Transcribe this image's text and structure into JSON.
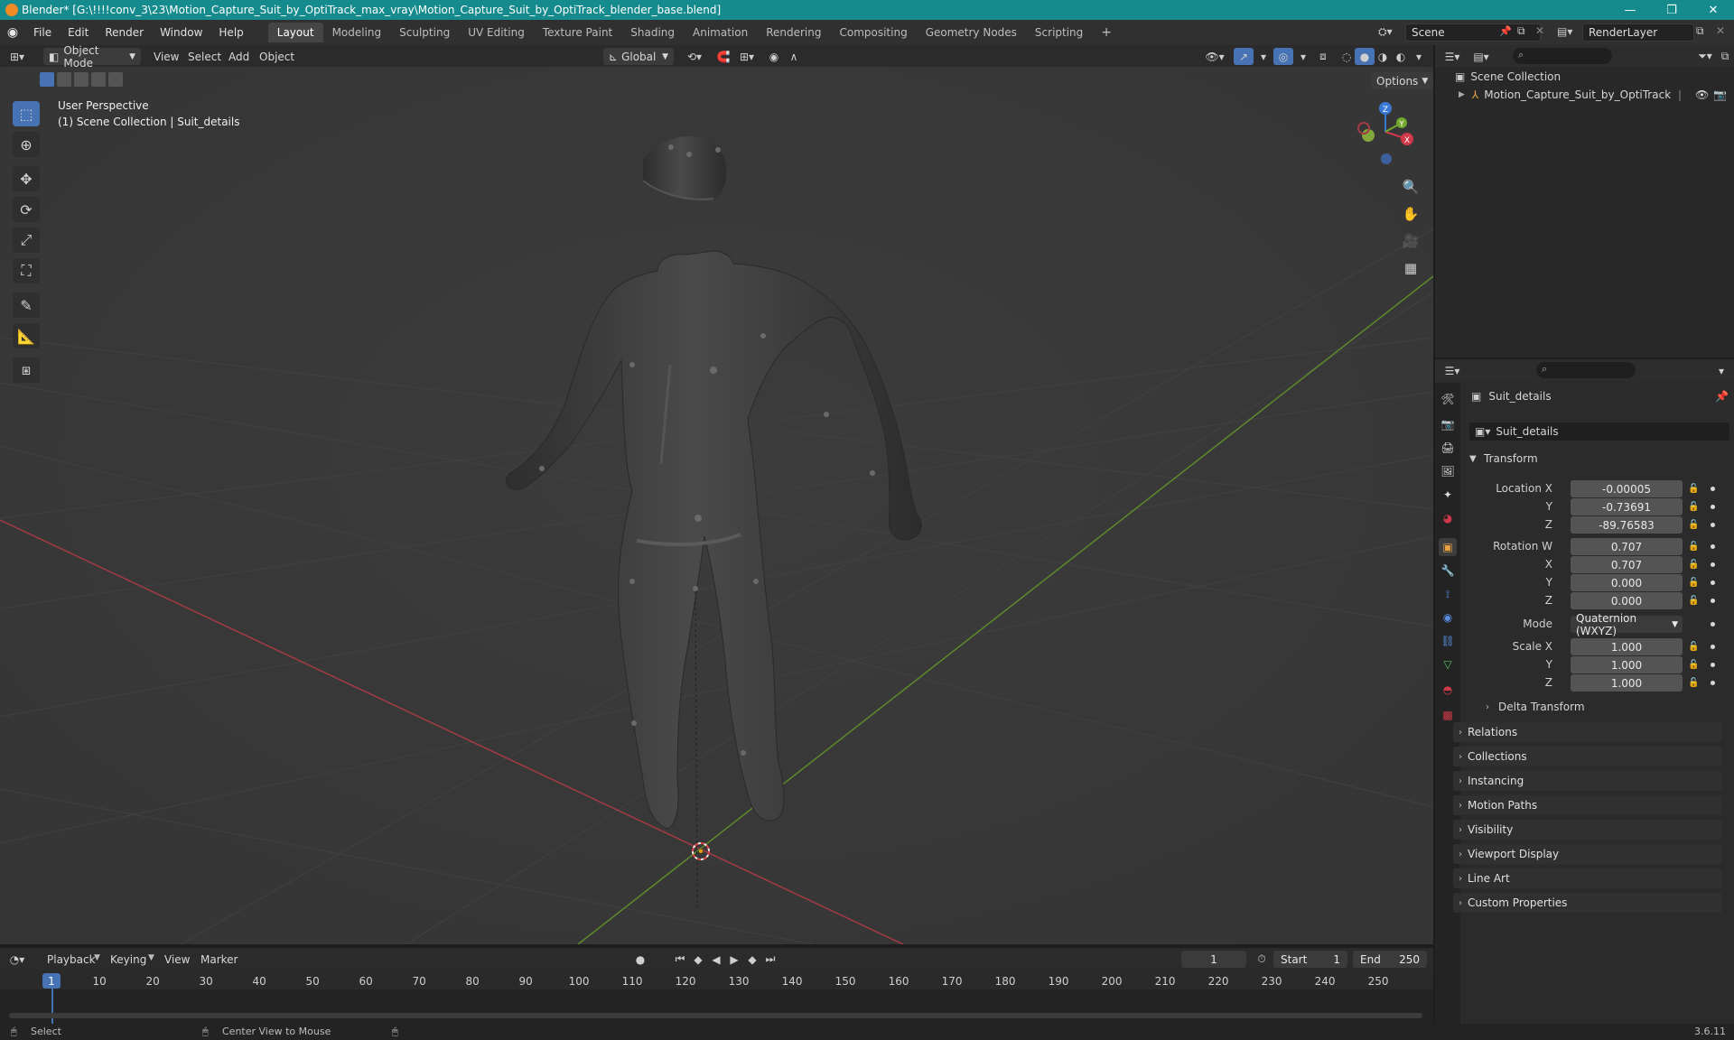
{
  "window": {
    "title": "Blender* [G:\\!!!!conv_3\\23\\Motion_Capture_Suit_by_OptiTrack_max_vray\\Motion_Capture_Suit_by_OptiTrack_blender_base.blend]",
    "minimize": "—",
    "maximize": "❐",
    "close": "✕"
  },
  "menu": [
    "File",
    "Edit",
    "Render",
    "Window",
    "Help"
  ],
  "workspaces": [
    "Layout",
    "Modeling",
    "Sculpting",
    "UV Editing",
    "Texture Paint",
    "Shading",
    "Animation",
    "Rendering",
    "Compositing",
    "Geometry Nodes",
    "Scripting"
  ],
  "active_workspace": "Layout",
  "add_workspace": "+",
  "scene_name": "Scene",
  "view_layer": "RenderLayer",
  "viewport_header": {
    "mode": "Object Mode",
    "menus": [
      "View",
      "Select",
      "Add",
      "Object"
    ],
    "transform_orientation": "Global",
    "options": "Options"
  },
  "viewport": {
    "perspective_label": "User Perspective",
    "collection_label": "(1) Scene Collection | Suit_details",
    "gizmo_axes": {
      "x": "X",
      "y": "Y",
      "z": "Z"
    }
  },
  "outliner": {
    "root": "Scene Collection",
    "items": [
      {
        "name": "Motion_Capture_Suit_by_OptiTrack"
      }
    ]
  },
  "properties": {
    "object_name": "Suit_details",
    "datablock_name": "Suit_details",
    "transform_panel": "Transform",
    "location": {
      "label": "Location X",
      "x": "-0.00005",
      "y": "-0.73691",
      "z": "-89.76583"
    },
    "rotation": {
      "label": "Rotation W",
      "w": "0.707",
      "x": "0.707",
      "y": "0.000",
      "z": "0.000"
    },
    "mode_label": "Mode",
    "mode_value": "Quaternion (WXYZ)",
    "scale": {
      "label": "Scale X",
      "x": "1.000",
      "y": "1.000",
      "z": "1.000"
    },
    "axis_labels": {
      "x": "X",
      "y": "Y",
      "z": "Z"
    },
    "delta_transform": "Delta Transform",
    "panels": [
      "Relations",
      "Collections",
      "Instancing",
      "Motion Paths",
      "Visibility",
      "Viewport Display",
      "Line Art",
      "Custom Properties"
    ]
  },
  "timeline": {
    "menus": [
      "Playback",
      "Keying",
      "View",
      "Marker"
    ],
    "current_frame": "1",
    "start_label": "Start",
    "start": "1",
    "end_label": "End",
    "end": "250",
    "ruler": [
      "1",
      "10",
      "20",
      "30",
      "40",
      "50",
      "60",
      "70",
      "80",
      "90",
      "100",
      "110",
      "120",
      "130",
      "140",
      "150",
      "160",
      "170",
      "180",
      "190",
      "200",
      "210",
      "220",
      "230",
      "240",
      "250"
    ]
  },
  "status": {
    "select": "Select",
    "center_view": "Center View to Mouse",
    "version": "3.6.11"
  }
}
